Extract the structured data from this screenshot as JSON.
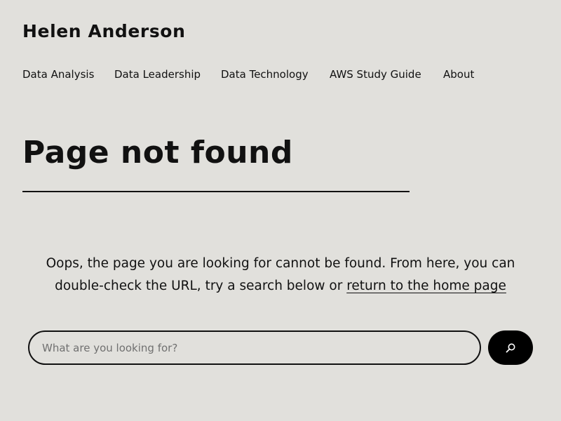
{
  "site": {
    "title": "Helen Anderson"
  },
  "nav": {
    "items": [
      {
        "label": "Data Analysis"
      },
      {
        "label": "Data Leadership"
      },
      {
        "label": "Data Technology"
      },
      {
        "label": "AWS Study Guide"
      },
      {
        "label": "About"
      }
    ]
  },
  "main": {
    "title": "Page not found",
    "message_part1": "Oops, the page you are looking for cannot be found. From here, you can double-check the URL, try a search below or ",
    "home_link": "return to the home page"
  },
  "search": {
    "placeholder": "What are you looking for?",
    "value": "",
    "button_icon": "search-icon"
  },
  "colors": {
    "background": "#e1e0dc",
    "text": "#111111",
    "button": "#000000",
    "placeholder": "#707070"
  }
}
